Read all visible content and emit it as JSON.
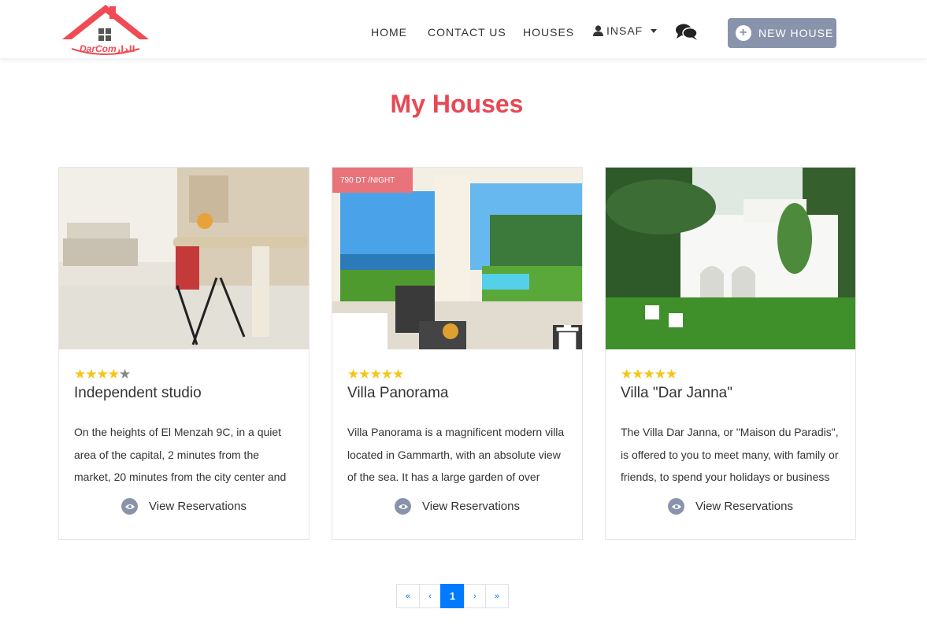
{
  "header": {
    "logo_text": "DarCom",
    "logo_arabic": "الدار",
    "nav": {
      "home": "HOME",
      "contact": "CONTACT US",
      "houses": "HOUSES",
      "user": "INSAF"
    },
    "new_house_label": "NEW HOUSE",
    "colors": {
      "brand_red": "#f04b55",
      "button": "#8993ab"
    }
  },
  "page_title": "My Houses",
  "cards": [
    {
      "title": "Independent studio",
      "rating": 4,
      "stars_on": "★★★★",
      "stars_off": "★",
      "description": "On the heights of El Menzah 9C, in a quiet area of the capital, 2 minutes from the market, 20 minutes from the city center and",
      "action_label": "View Reservations",
      "price": ""
    },
    {
      "title": "Villa Panorama",
      "rating": 5,
      "stars_on": "★★★★★",
      "stars_off": "",
      "description": "Villa Panorama is a magnificent modern villa located in Gammarth, with an absolute view of the sea. It has a large garden of over",
      "action_label": "View Reservations",
      "price": "790 DT /NIGHT"
    },
    {
      "title": "Villa \"Dar Janna\"",
      "rating": 5,
      "stars_on": "★★★★★",
      "stars_off": "",
      "description": "The Villa Dar Janna, or \"Maison du Paradis\", is offered to you to meet many, with family or friends, to spend your holidays or business",
      "action_label": "View Reservations",
      "price": ""
    }
  ],
  "pagination": {
    "first": "«",
    "prev": "‹",
    "current": "1",
    "next": "›",
    "last": "»"
  }
}
